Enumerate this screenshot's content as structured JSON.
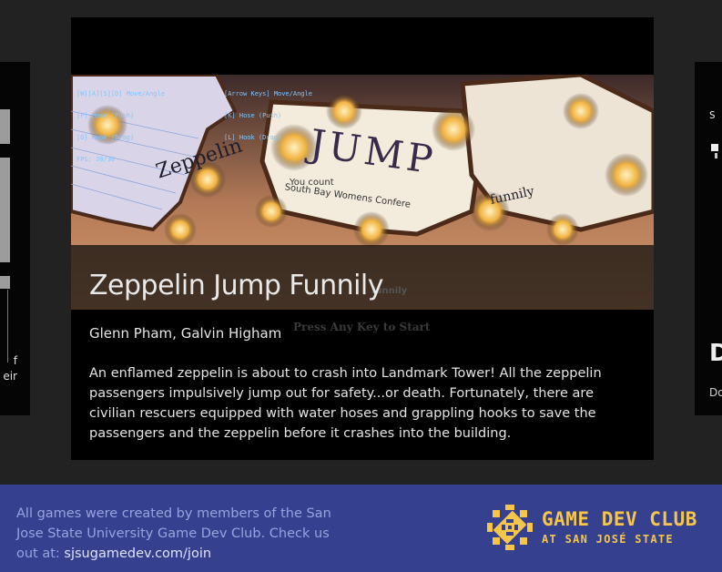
{
  "left_card": {
    "partial_text_lines": [
      "f",
      "eir"
    ]
  },
  "right_card": {
    "pixel_text": "S",
    "title": "D",
    "text": "Do"
  },
  "main_card": {
    "screenshot": {
      "hud_left": [
        "[W][A][S][D] Move/Angle",
        "[F] Hose (Push)",
        "[G] Hook (Drag)",
        "FPS: 30/30"
      ],
      "hud_right": [
        "[Arrow Keys] Move/Angle",
        "[K] Hose (Push)",
        "[L] Hook (Drag)"
      ],
      "doodle_zeppelin": "Zeppelin",
      "doodle_jump": "JUMP",
      "doodle_funnily": "funnily",
      "paper_text_1": "You count",
      "paper_text_2": "South Bay Womens Confere",
      "behind_title_text": "funnily",
      "press_key": "Press Any Key to Start"
    },
    "title": "Zeppelin Jump Funnily",
    "authors": "Glenn Pham, Galvin Higham",
    "description": "An enflamed zeppelin is about to crash into Landmark Tower! All the zeppelin passengers impulsively jump out for safety...or death. Fortunately, there are civilian rescuers equipped with water hoses and grappling hooks to save the passengers and the zeppelin before it crashes into the building."
  },
  "footer": {
    "text": "All games were created by members of the San Jose State University Game Dev Club. Check us out at: ",
    "link_text": "sjsugamedev.com/join",
    "logo_line1": "GAME DEV CLUB",
    "logo_line2": "AT SAN JOSÉ STATE"
  },
  "colors": {
    "page_bg": "#222222",
    "card_bg": "#000000",
    "footer_bg": "#35408f",
    "footer_text": "#98a4dd",
    "logo": "#f6c64a"
  }
}
